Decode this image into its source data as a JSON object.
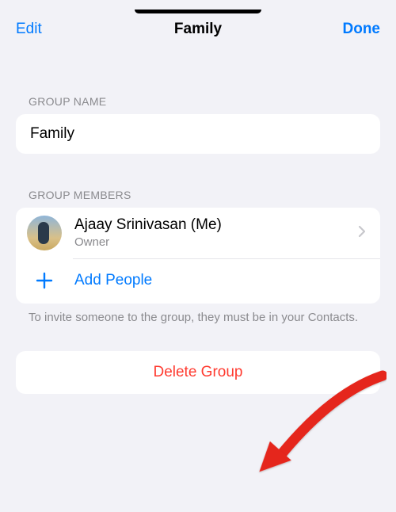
{
  "header": {
    "edit": "Edit",
    "title": "Family",
    "done": "Done"
  },
  "sections": {
    "group_name": {
      "header": "GROUP NAME",
      "value": "Family"
    },
    "group_members": {
      "header": "GROUP MEMBERS",
      "members": [
        {
          "name": "Ajaay Srinivasan (Me)",
          "role": "Owner"
        }
      ],
      "add_label": "Add People",
      "footer": "To invite someone to the group, they must be in your Contacts."
    }
  },
  "delete_label": "Delete Group"
}
